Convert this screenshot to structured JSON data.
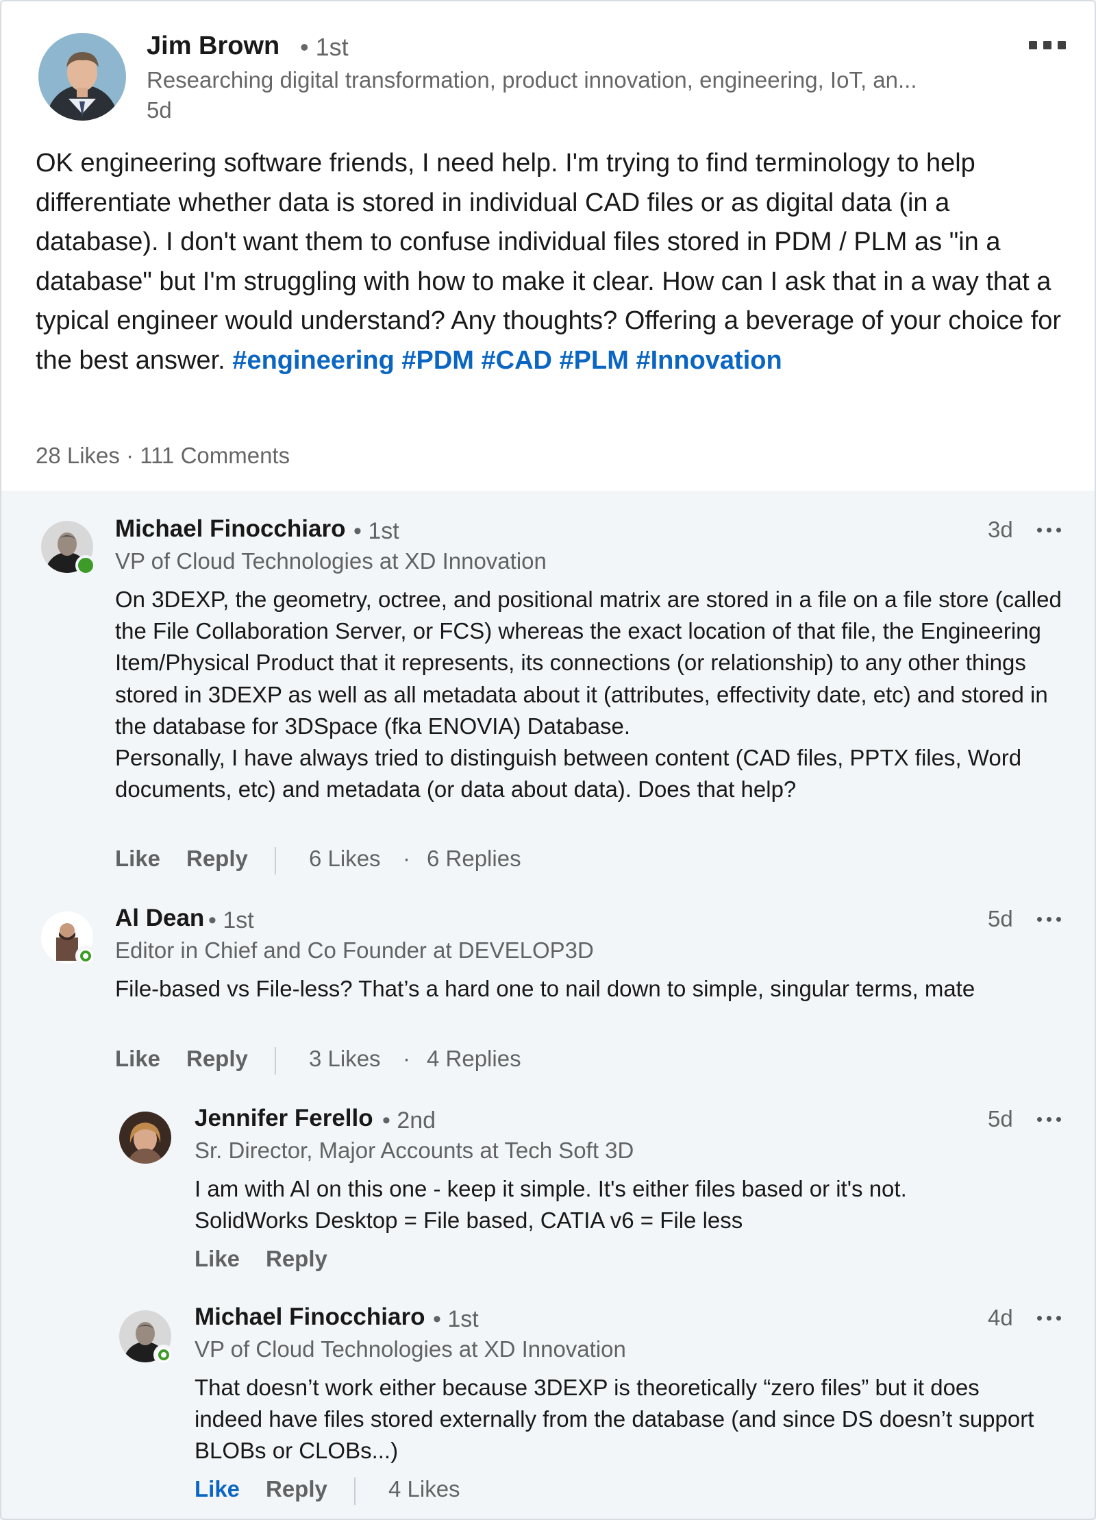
{
  "post": {
    "author_name": "Jim Brown",
    "author_degree": "1st",
    "author_headline": "Researching digital transformation, product innovation, engineering, IoT, an...",
    "time": "5d",
    "body_text": "OK engineering software friends, I need help. I'm trying to find terminology to help differentiate whether data is stored in individual CAD files or as digital data (in a database). I don't want them to confuse individual files stored in PDM / PLM as \"in a database\" but I'm struggling with how to make it clear. How can I ask that in a way that a typical engineer would understand? Any thoughts? Offering a beverage of your choice for the best answer. ",
    "hashtags": [
      "#engineering",
      "#PDM",
      "#CAD",
      "#PLM",
      "#Innovation"
    ],
    "stats": "28 Likes · 111 Comments",
    "menu_icon": "more-horizontal-icon"
  },
  "comments": [
    {
      "name": "Michael Finocchiaro",
      "degree": "1st",
      "headline": "VP of Cloud Technologies at XD Innovation",
      "time": "3d",
      "presence": "active",
      "text": "On 3DEXP, the geometry, octree, and positional matrix are stored in a file on a file store (called the File Collaboration Server, or FCS) whereas the exact location of that file, the Engineering Item/Physical Product that it represents, its connections (or relationship) to any other things stored in 3DEXP as well as all metadata about it (attributes, effectivity date, etc) and stored in the database for 3DSpace (fka ENOVIA) Database.\nPersonally, I have always tried to distinguish between content (CAD files, PPTX files, Word documents, etc) and metadata (or data about data). Does that help?",
      "like_label": "Like",
      "reply_label": "Reply",
      "likes": "6 Likes",
      "replies": "6 Replies"
    },
    {
      "name": "Al Dean",
      "degree": "1st",
      "headline": "Editor in Chief and Co Founder at DEVELOP3D",
      "time": "5d",
      "presence": "ring",
      "text": "File-based vs File-less? That’s a hard one to nail down to simple, singular terms, mate",
      "like_label": "Like",
      "reply_label": "Reply",
      "likes": "3 Likes",
      "replies": "4 Replies"
    },
    {
      "name": "Jennifer Ferello",
      "degree": "2nd",
      "headline": "Sr. Director, Major Accounts at Tech Soft 3D",
      "time": "5d",
      "presence": "none",
      "text": "I am with Al on this one - keep it simple. It's either files based or it's not. SolidWorks Desktop = File based, CATIA v6 = File less",
      "like_label": "Like",
      "reply_label": "Reply"
    },
    {
      "name": "Michael Finocchiaro",
      "degree": "1st",
      "headline": "VP of Cloud Technologies at XD Innovation",
      "time": "4d",
      "presence": "ring",
      "text": "That doesn’t work either because 3DEXP is theoretically “zero files” but it does indeed have files stored externally from the database (and since DS doesn’t support BLOBs or CLOBs...)",
      "like_label": "Like",
      "reply_label": "Reply",
      "likes": "4 Likes",
      "like_active": true
    }
  ],
  "colors": {
    "link_blue": "#0a66c2",
    "presence_green": "#3d9c28",
    "comment_bg": "#f3f6f8"
  }
}
